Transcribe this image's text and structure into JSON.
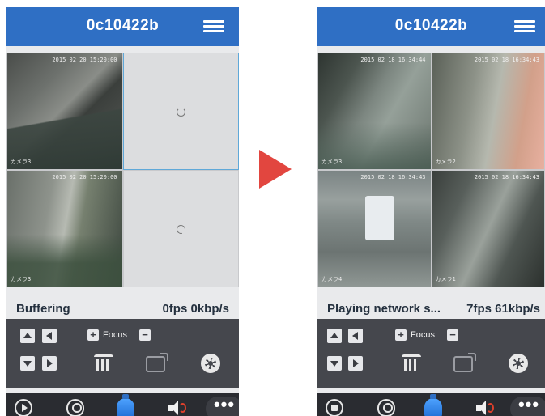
{
  "colors": {
    "titlebar": "#2f6fc4",
    "controls_bg": "#45474d",
    "bottombar_bg": "#2a2c31",
    "transition_arrow": "#e2463f",
    "selected_cell_border": "#5fa8d8"
  },
  "left": {
    "title": "0c10422b",
    "status": "Buffering",
    "rate": "0fps 0kbp/s",
    "focus_label": "Focus",
    "focus_plus": "+",
    "focus_minus": "−",
    "cells": [
      {
        "timestamp": "2015 02 20 15:20:00",
        "label": "カメラ3",
        "state": "video"
      },
      {
        "state": "loading"
      },
      {
        "timestamp": "2015 02 20 15:20:00",
        "label": "カメラ3",
        "state": "video"
      },
      {
        "state": "loading"
      }
    ],
    "more_label": "•••"
  },
  "right": {
    "title": "0c10422b",
    "status": "Playing network s...",
    "rate": "7fps 61kbp/s",
    "focus_label": "Focus",
    "focus_plus": "+",
    "focus_minus": "−",
    "cells": [
      {
        "timestamp": "2015 02 18 16:34:44",
        "label": "カメラ3",
        "state": "video"
      },
      {
        "timestamp": "2015 02 18 16:34:43",
        "label": "カメラ2",
        "state": "video"
      },
      {
        "timestamp": "2015 02 18 16:34:43",
        "label": "カメラ4",
        "state": "video"
      },
      {
        "timestamp": "2015 02 18 16:34:43",
        "label": "カメラ1",
        "state": "video"
      }
    ],
    "more_label": "•••"
  }
}
